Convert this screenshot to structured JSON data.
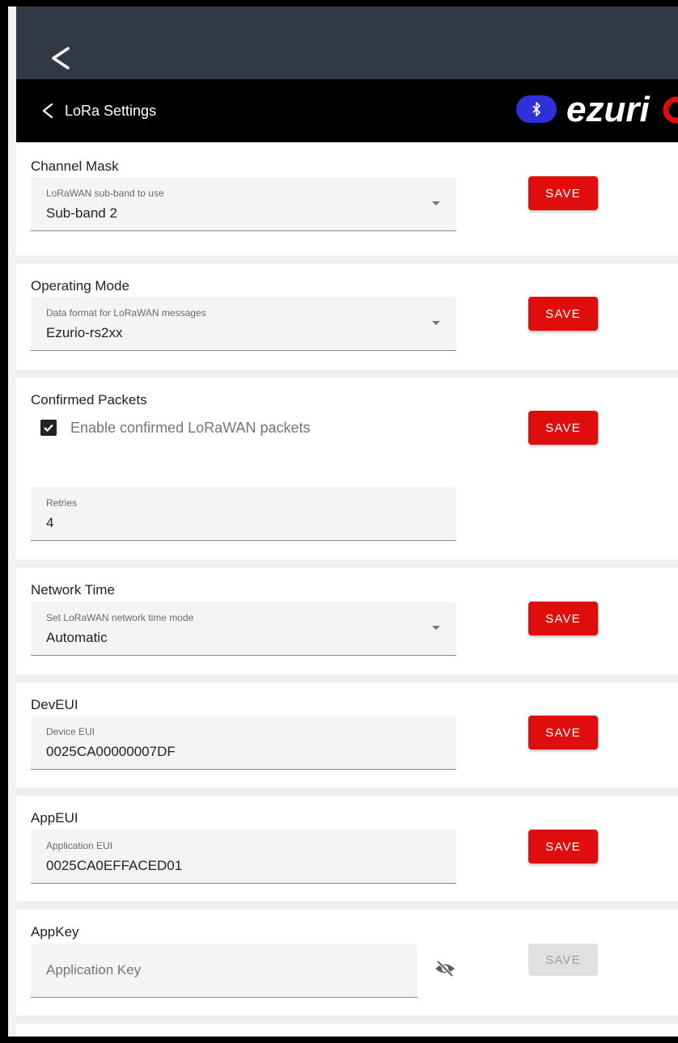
{
  "app": {
    "screen_title": "LoRa Settings",
    "bluetooth_color": "#3030d8",
    "accent_color": "#e00d0d",
    "logo_text": "ezurio"
  },
  "sections": {
    "channel_mask": {
      "title": "Channel Mask",
      "field_label": "LoRaWAN sub-band to use",
      "field_value": "Sub-band 2",
      "save_label": "SAVE"
    },
    "operating_mode": {
      "title": "Operating Mode",
      "field_label": "Data format for LoRaWAN messages",
      "field_value": "Ezurio-rs2xx",
      "save_label": "SAVE"
    },
    "confirmed_packets": {
      "title": "Confirmed Packets",
      "checkbox_label": "Enable confirmed LoRaWAN packets",
      "checked": true,
      "retries_label": "Retries",
      "retries_value": "4",
      "save_label": "SAVE"
    },
    "network_time": {
      "title": "Network Time",
      "field_label": "Set LoRaWAN network time mode",
      "field_value": "Automatic",
      "save_label": "SAVE"
    },
    "dev_eui": {
      "title": "DevEUI",
      "field_label": "Device EUI",
      "field_value": "0025CA00000007DF",
      "save_label": "SAVE"
    },
    "app_eui": {
      "title": "AppEUI",
      "field_label": "Application EUI",
      "field_value": "0025CA0EFFACED01",
      "save_label": "SAVE"
    },
    "app_key": {
      "title": "AppKey",
      "placeholder": "Application Key",
      "save_label": "SAVE",
      "save_enabled": false
    }
  }
}
